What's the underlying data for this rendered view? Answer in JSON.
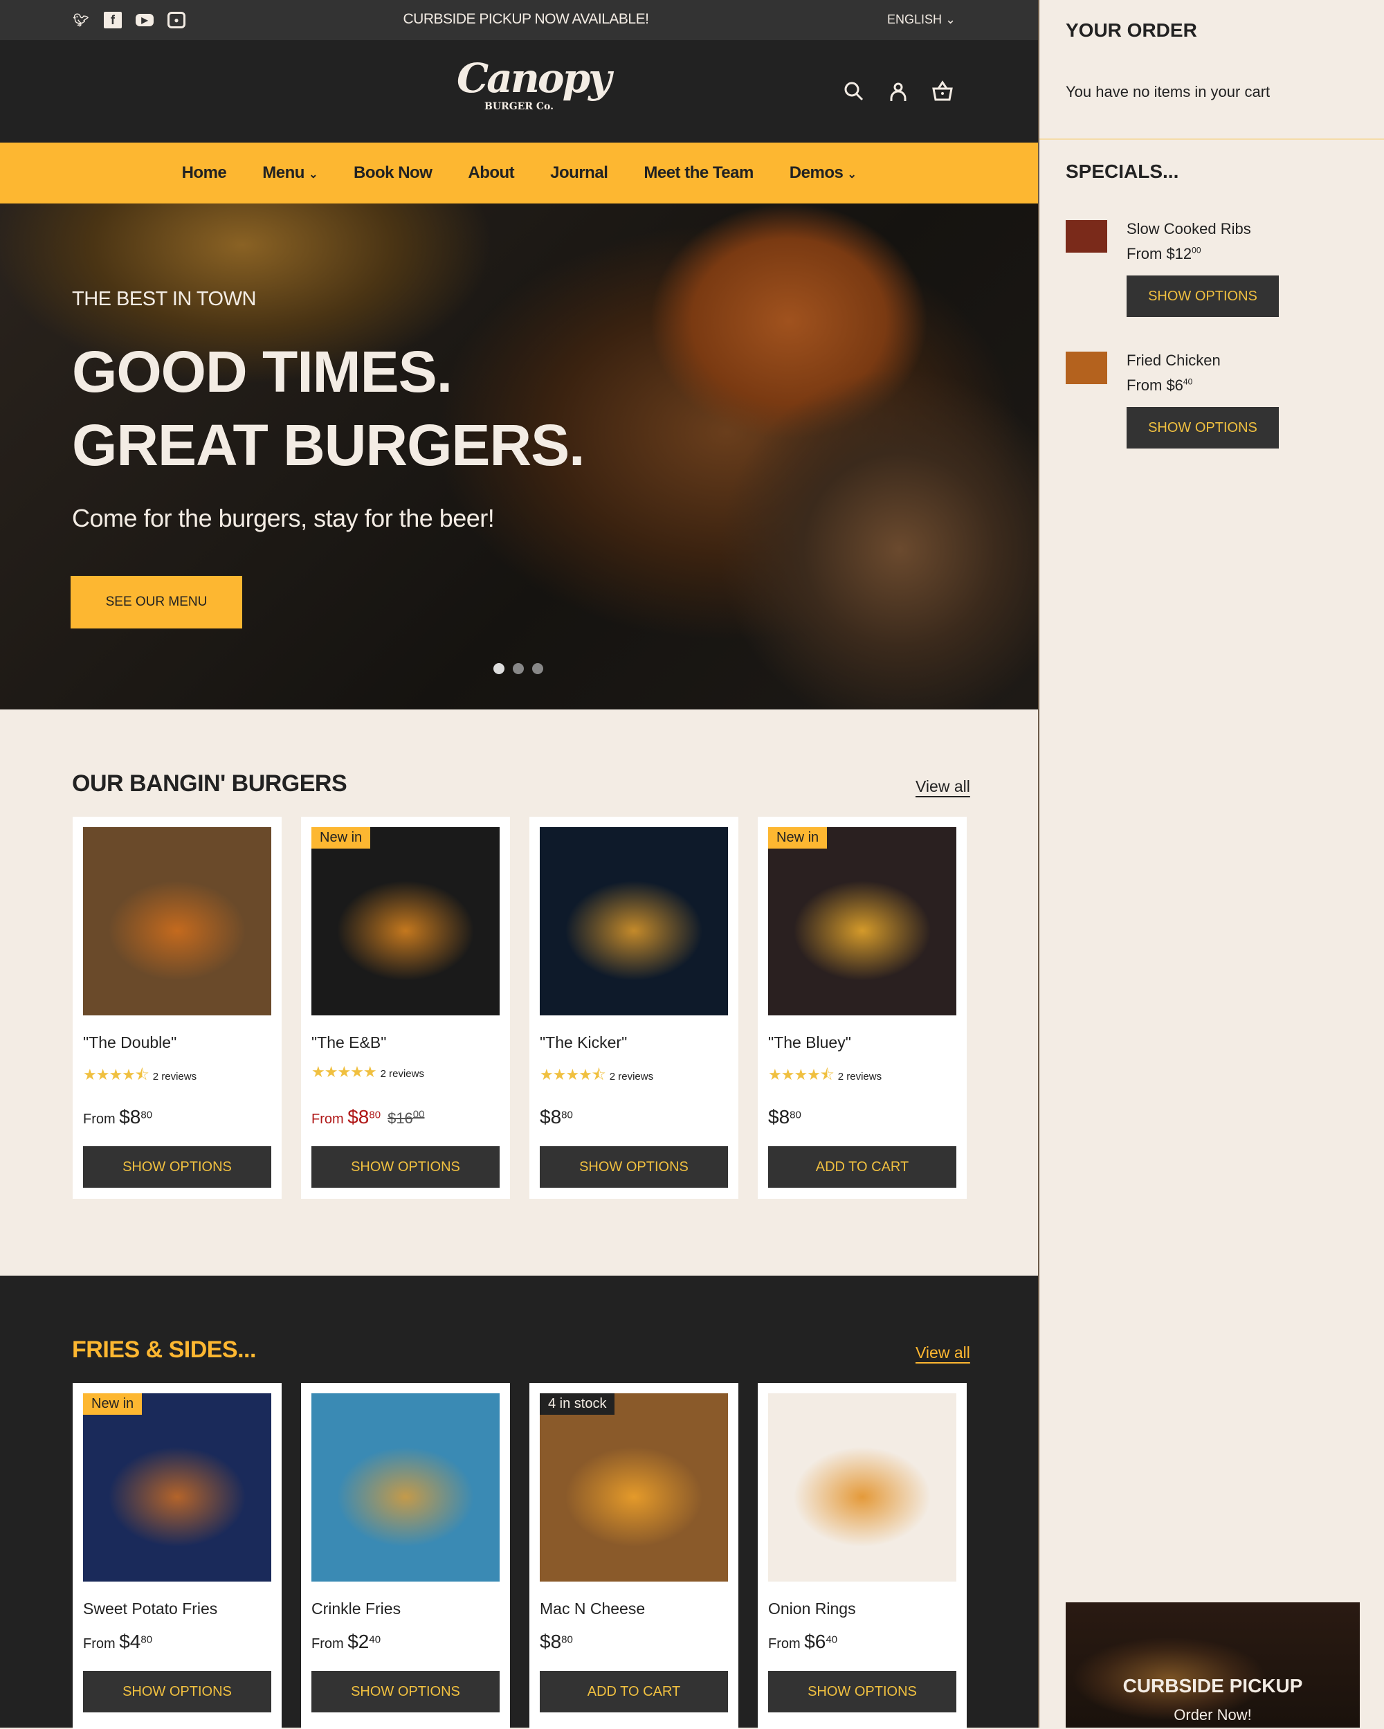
{
  "topbar": {
    "announcement": "CURBSIDE PICKUP NOW AVAILABLE!",
    "language": "ENGLISH",
    "social": [
      "twitter-icon",
      "facebook-icon",
      "youtube-icon",
      "instagram-icon"
    ]
  },
  "header": {
    "logo_script": "Canopy",
    "logo_sub": "BURGER Co."
  },
  "nav": [
    "Home",
    "Menu",
    "Book Now",
    "About",
    "Journal",
    "Meet the Team",
    "Demos"
  ],
  "hero": {
    "kicker": "THE BEST IN TOWN",
    "line1": "GOOD TIMES.",
    "line2": "GREAT BURGERS.",
    "tagline": "Come for the burgers, stay for the beer!",
    "cta": "SEE OUR MENU",
    "slides": 3,
    "active_slide": 1
  },
  "burgers": {
    "title": "OUR BANGIN' BURGERS",
    "view_all": "View all",
    "items": [
      {
        "name": "\"The Double\"",
        "badge": "",
        "rating": 4.5,
        "reviews": "2 reviews",
        "prefix": "From",
        "dollars": "$8",
        "cents": "80",
        "compare": "",
        "button": "SHOW OPTIONS",
        "colors": [
          "#6a4a2a",
          "#c46a1e"
        ]
      },
      {
        "name": "\"The E&B\"",
        "badge": "New in",
        "rating": 5,
        "reviews": "2 reviews",
        "prefix": "From",
        "dollars": "$8",
        "cents": "80",
        "compare": "$16",
        "compare_cents": "00",
        "sale": true,
        "button": "SHOW OPTIONS",
        "colors": [
          "#1a1a1a",
          "#c4781e"
        ]
      },
      {
        "name": "\"The Kicker\"",
        "badge": "",
        "rating": 4.5,
        "reviews": "2 reviews",
        "prefix": "",
        "dollars": "$8",
        "cents": "80",
        "compare": "",
        "button": "SHOW OPTIONS",
        "colors": [
          "#0e1a2a",
          "#c48a2a"
        ]
      },
      {
        "name": "\"The Bluey\"",
        "badge": "New in",
        "rating": 4.5,
        "reviews": "2 reviews",
        "prefix": "",
        "dollars": "$8",
        "cents": "80",
        "compare": "",
        "button": "ADD TO CART",
        "colors": [
          "#2a2020",
          "#d49a2a"
        ]
      }
    ]
  },
  "sides": {
    "title": "FRIES & SIDES...",
    "view_all": "View all",
    "items": [
      {
        "name": "Sweet Potato Fries",
        "badge": "New in",
        "prefix": "From",
        "dollars": "$4",
        "cents": "80",
        "button": "SHOW OPTIONS",
        "colors": [
          "#1a2a5a",
          "#b4642a"
        ]
      },
      {
        "name": "Crinkle Fries",
        "badge": "",
        "prefix": "From",
        "dollars": "$2",
        "cents": "40",
        "button": "SHOW OPTIONS",
        "colors": [
          "#3a8ab4",
          "#c49a4a"
        ]
      },
      {
        "name": "Mac N Cheese",
        "badge": "4 in stock",
        "badge_dark": true,
        "prefix": "",
        "dollars": "$8",
        "cents": "80",
        "button": "ADD TO CART",
        "colors": [
          "#8a5a2a",
          "#e49a2a"
        ]
      },
      {
        "name": "Onion Rings",
        "badge": "",
        "prefix": "From",
        "dollars": "$6",
        "cents": "40",
        "button": "SHOW OPTIONS",
        "colors": [
          "#f3ece4",
          "#e49a3a"
        ]
      }
    ]
  },
  "sidebar": {
    "order_title": "YOUR ORDER",
    "empty": "You have no items in your cart",
    "specials_title": "SPECIALS...",
    "specials": [
      {
        "name": "Slow Cooked Ribs",
        "price": "From $12",
        "cents": "00",
        "button": "SHOW OPTIONS",
        "color": "#7a2a1a"
      },
      {
        "name": "Fried Chicken",
        "price": "From $6",
        "cents": "40",
        "button": "SHOW OPTIONS",
        "color": "#b4621e"
      }
    ],
    "banner": {
      "title": "CURBSIDE PICKUP",
      "subtitle": "Order Now!"
    }
  },
  "colors": {
    "accent": "#fdb731",
    "dark": "#222222",
    "cream": "#f3ece4",
    "sale": "#b01818"
  }
}
